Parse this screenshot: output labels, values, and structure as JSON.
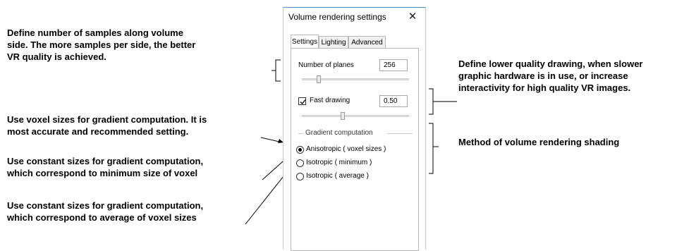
{
  "dialog": {
    "title": "Volume rendering settings",
    "close_glyph": "✕",
    "tabs": [
      {
        "label": "Settings",
        "active": true
      },
      {
        "label": "Lighting",
        "active": false
      },
      {
        "label": "Advanced",
        "active": false
      }
    ],
    "number_of_planes": {
      "label": "Number of planes",
      "value": "256",
      "slider_fraction": 0.28
    },
    "fast_drawing": {
      "label": "Fast drawing",
      "checked": true,
      "value": "0.50",
      "slider_fraction": 0.5
    },
    "gradient": {
      "group_label": "Gradient computation",
      "options": [
        {
          "label": "Anisotropic ( voxel sizes )",
          "selected": true
        },
        {
          "label": "Isotropic ( minimum )",
          "selected": false
        },
        {
          "label": "Isotropic ( average )",
          "selected": false
        }
      ]
    }
  },
  "annotations": {
    "samples": {
      "l1": "Define number of samples along volume",
      "l2": "side. The more samples per side, the better",
      "l3": "VR quality is achieved."
    },
    "voxel": {
      "l1": "Use voxel sizes for gradient computation. It is",
      "l2": "most accurate and recommended setting."
    },
    "constant_min": {
      "l1": "Use constant sizes for gradient computation,",
      "l2": "which correspond to minimum size of voxel"
    },
    "constant_avg": {
      "l1": "Use constant sizes for gradient computation,",
      "l2": "which correspond to average of voxel sizes"
    },
    "lower_quality": {
      "l1": "Define lower quality drawing, when slower",
      "l2": "graphic hardware is in use, or increase",
      "l3": "interactivity for high quality VR images."
    },
    "shading": {
      "l1": "Method of volume rendering shading"
    }
  }
}
